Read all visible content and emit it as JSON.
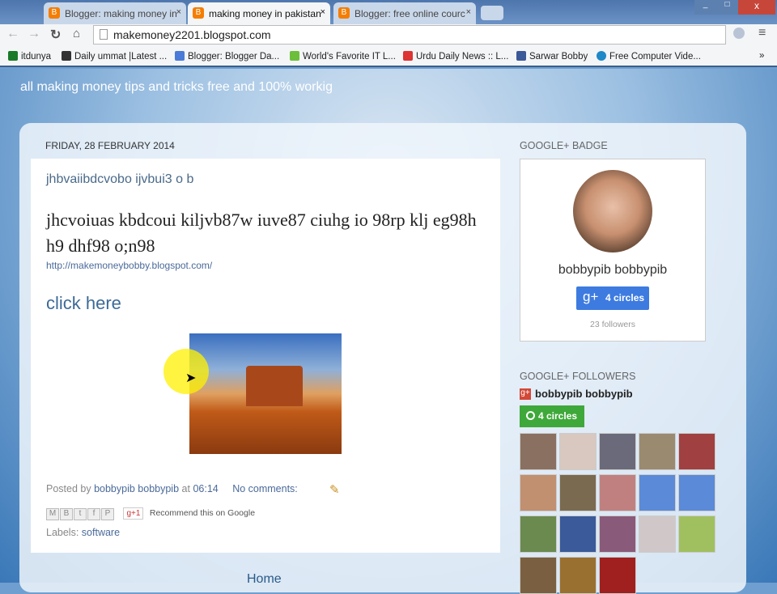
{
  "browser": {
    "tabs": [
      {
        "label": "Blogger: making money in"
      },
      {
        "label": "making money in pakistan"
      },
      {
        "label": "Blogger: free online courc"
      }
    ],
    "url": "makemoney2201.blogspot.com",
    "bookmarks": [
      {
        "label": "itdunya",
        "color": "#1a7a2a"
      },
      {
        "label": "Daily ummat |Latest ...",
        "color": "#333"
      },
      {
        "label": "Blogger: Blogger Da...",
        "color": "#4a7bd8"
      },
      {
        "label": "World's Favorite IT L...",
        "color": "#6cbf3a"
      },
      {
        "label": "Urdu Daily News :: L...",
        "color": "#d33"
      },
      {
        "label": "Sarwar Bobby",
        "color": "#3b5998"
      },
      {
        "label": "Free Computer Vide...",
        "color": "#1e88c8"
      }
    ]
  },
  "blog": {
    "description": "all making money tips and tricks free and 100% workig",
    "date": "FRIDAY, 28 FEBRUARY 2014",
    "post_title": "jhbvaiibdcvobo ijvbui3 o b",
    "body": "jhcvoiuas kbdcoui kiljvb87w iuve87 ciuhg io 98rp klj eg98h  h9 dhf98 o;n98",
    "link": "http://makemoneybobby.blogspot.com/",
    "click_here": "click here",
    "posted_by": "Posted by",
    "author": "bobbypib bobbypib",
    "at": "at",
    "time": "06:14",
    "comments": "No comments:",
    "plus_one": "+1",
    "recommend": "Recommend this on Google",
    "labels_label": "Labels:",
    "label": "software",
    "home": "Home"
  },
  "sidebar": {
    "badge_title": "GOOGLE+ BADGE",
    "badge_name": "bobbypib bobbypib",
    "circles_btn": "4 circles",
    "followers": "23 followers",
    "followers_title": "GOOGLE+ FOLLOWERS",
    "followers_name": "bobbypib bobbypib",
    "followers_circles": "4 circles"
  }
}
